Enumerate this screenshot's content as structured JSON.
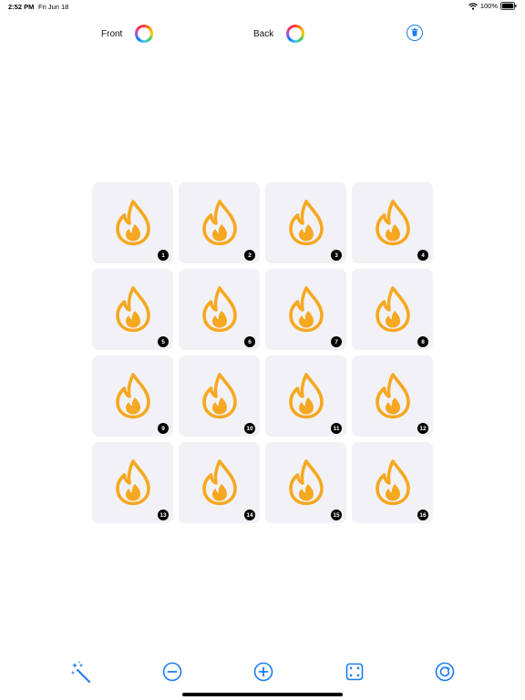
{
  "status_bar": {
    "time": "2:52 PM",
    "date": "Fri Jun 18",
    "battery": "100%"
  },
  "toolbar": {
    "front_label": "Front",
    "back_label": "Back"
  },
  "tiles": [
    "1",
    "2",
    "3",
    "4",
    "5",
    "6",
    "7",
    "8",
    "9",
    "10",
    "11",
    "12",
    "13",
    "14",
    "15",
    "16"
  ],
  "icons": {
    "tile_icon": "flame-icon",
    "bottom": [
      "magic-wand-icon",
      "minus-circle-icon",
      "plus-circle-icon",
      "fullscreen-icon",
      "rotate-icon"
    ]
  },
  "colors": {
    "accent": "#1a7cf0",
    "flame_orange": "#f6a821",
    "tile_background": "#f2f2f6",
    "badge": "#000000"
  }
}
